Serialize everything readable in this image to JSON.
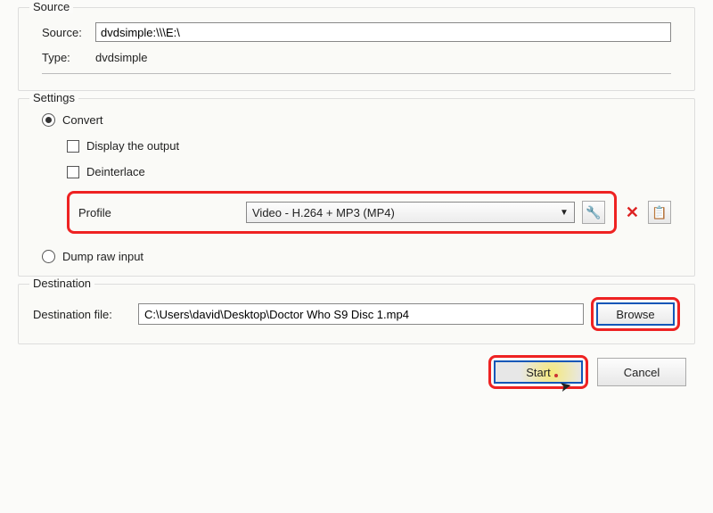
{
  "source": {
    "group_title": "Source",
    "source_label": "Source:",
    "source_value": "dvdsimple:\\\\\\E:\\",
    "type_label": "Type:",
    "type_value": "dvdsimple"
  },
  "settings": {
    "group_title": "Settings",
    "convert_label": "Convert",
    "display_output_label": "Display the output",
    "deinterlace_label": "Deinterlace",
    "profile_label": "Profile",
    "profile_value": "Video - H.264 + MP3 (MP4)",
    "wrench_icon": "wrench",
    "delete_icon": "delete",
    "list_icon": "list",
    "dump_label": "Dump raw input"
  },
  "destination": {
    "group_title": "Destination",
    "file_label": "Destination file:",
    "file_value": "C:\\Users\\david\\Desktop\\Doctor Who S9 Disc 1.mp4",
    "browse_label": "Browse"
  },
  "footer": {
    "start_label": "Start",
    "cancel_label": "Cancel"
  }
}
